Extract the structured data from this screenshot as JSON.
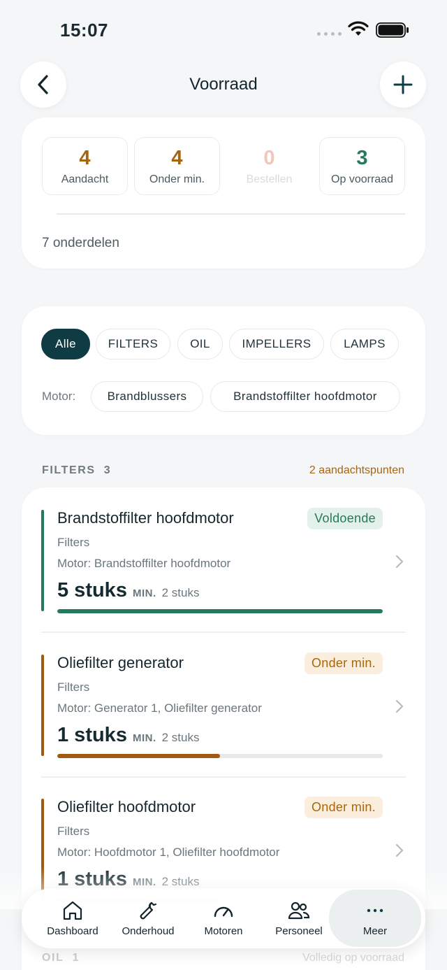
{
  "status_bar": {
    "time": "15:07"
  },
  "header": {
    "title": "Voorraad"
  },
  "summary": {
    "stats": [
      {
        "value": "4",
        "label": "Aandacht",
        "color": "#a86510"
      },
      {
        "value": "4",
        "label": "Onder min.",
        "color": "#a86510"
      },
      {
        "value": "0",
        "label": "Bestellen",
        "color": "#f0c6bd"
      },
      {
        "value": "3",
        "label": "Op voorraad",
        "color": "#247a5a"
      }
    ],
    "count_text": "7 onderdelen"
  },
  "filters": {
    "categories": [
      "Alle",
      "FILTERS",
      "OIL",
      "IMPELLERS",
      "LAMPS"
    ],
    "motor_label": "Motor:",
    "motors": [
      "Brandblussers",
      "Brandstoffilter hoofdmotor"
    ]
  },
  "section": {
    "title": "FILTERS",
    "count": "3",
    "alert": "2 aandachtspunten"
  },
  "items": [
    {
      "name": "Brandstoffilter hoofdmotor",
      "badge": "Voldoende",
      "category": "Filters",
      "motor": "Motor: Brandstoffilter hoofdmotor",
      "qty": "5 stuks",
      "min_label": "MIN.",
      "min_value": "2 stuks",
      "level": 1.0,
      "status_color": "#247a5a"
    },
    {
      "name": "Oliefilter generator",
      "badge": "Onder min.",
      "category": "Filters",
      "motor": "Motor: Generator 1, Oliefilter generator",
      "qty": "1 stuks",
      "min_label": "MIN.",
      "min_value": "2 stuks",
      "level": 0.5,
      "status_color": "#a25a12"
    },
    {
      "name": "Oliefilter hoofdmotor",
      "badge": "Onder min.",
      "category": "Filters",
      "motor": "Motor: Hoofdmotor 1, Oliefilter hoofdmotor",
      "qty": "1 stuks",
      "min_label": "MIN.",
      "min_value": "2 stuks",
      "level": 0.5,
      "status_color": "#a25a12"
    }
  ],
  "next_section": {
    "title": "OIL",
    "count": "1",
    "alert": "Volledig op voorraad"
  },
  "tabbar": {
    "tabs": [
      {
        "label": "Dashboard",
        "icon": "home-icon"
      },
      {
        "label": "Onderhoud",
        "icon": "wrench-icon"
      },
      {
        "label": "Motoren",
        "icon": "gauge-icon"
      },
      {
        "label": "Personeel",
        "icon": "people-icon"
      },
      {
        "label": "Meer",
        "icon": "more-icon"
      }
    ]
  }
}
